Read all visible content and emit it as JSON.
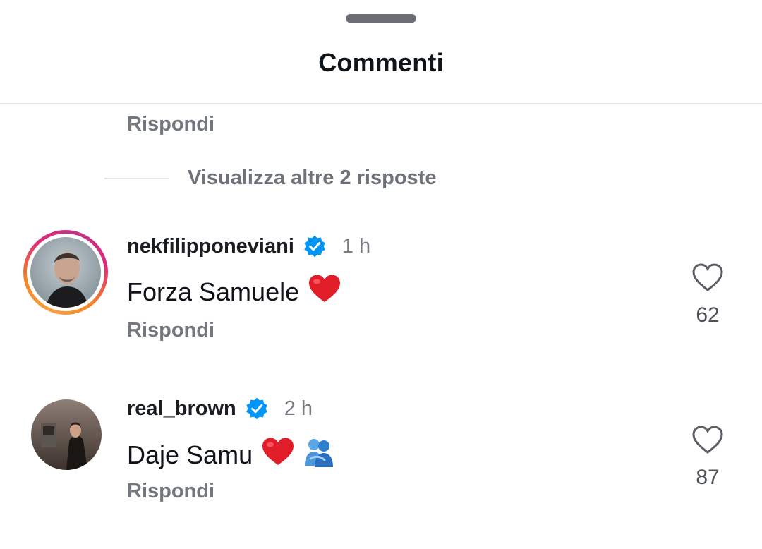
{
  "header": {
    "title": "Commenti"
  },
  "top_reply_label": "Rispondi",
  "view_more": {
    "label": "Visualizza altre 2 risposte"
  },
  "comments": [
    {
      "username": "nekfilipponeviani",
      "verified": true,
      "time": "1 h",
      "text": "Forza Samuele",
      "emojis": [
        "red-heart"
      ],
      "reply_label": "Rispondi",
      "likes": "62",
      "has_story_ring": true
    },
    {
      "username": "real_brown",
      "verified": true,
      "time": "2 h",
      "text": "Daje Samu",
      "emojis": [
        "red-heart",
        "people-hugging"
      ],
      "reply_label": "Rispondi",
      "likes": "87",
      "has_story_ring": false
    }
  ],
  "colors": {
    "verified_blue": "#0095f6",
    "heart_red": "#e11d2a",
    "muted_text": "#73787e",
    "story_ring_start": "#f58529",
    "story_ring_end": "#c13584"
  }
}
